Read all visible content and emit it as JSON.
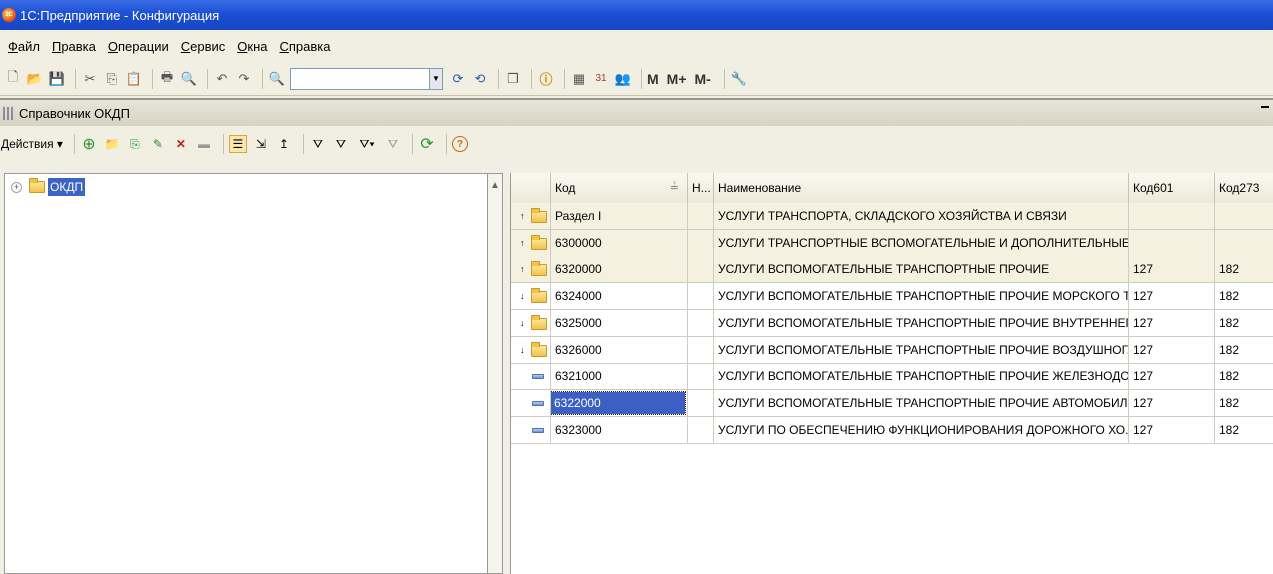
{
  "window": {
    "title": "1С:Предприятие - Конфигурация",
    "logo_text": "1С"
  },
  "menu": [
    {
      "label": "Файл",
      "ul": "Ф",
      "rest": "айл"
    },
    {
      "label": "Правка",
      "ul": "П",
      "rest": "равка"
    },
    {
      "label": "Операции",
      "ul": "О",
      "rest": "перации"
    },
    {
      "label": "Сервис",
      "ul": "С",
      "rest": "ервис"
    },
    {
      "label": "Окна",
      "ul": "О",
      "rest": "кна"
    },
    {
      "label": "Справка",
      "ul": "С",
      "rest": "правка"
    }
  ],
  "toolbar": {
    "search_value": "",
    "m_label": "M",
    "mplus_label": "M+",
    "mminus_label": "M-"
  },
  "document": {
    "title": "Справочник ОКДП"
  },
  "form_toolbar": {
    "actions_label": "Действия"
  },
  "tree": {
    "root_label": "ОКДП"
  },
  "grid": {
    "columns": [
      "Код",
      "Н...",
      "Наименование",
      "Код601",
      "Код273"
    ],
    "rows": [
      {
        "type": "folder",
        "arrow": "up",
        "code": "Раздел I",
        "n": "",
        "name": "УСЛУГИ ТРАНСПОРТА, СКЛАДСКОГО ХОЗЯЙСТВА И СВЯЗИ",
        "k601": "",
        "k273": ""
      },
      {
        "type": "folder",
        "arrow": "up",
        "code": "6300000",
        "n": "",
        "name": "УСЛУГИ ТРАНСПОРТНЫЕ ВСПОМОГАТЕЛЬНЫЕ И ДОПОЛНИТЕЛЬНЫЕ...",
        "k601": "",
        "k273": ""
      },
      {
        "type": "folder",
        "arrow": "up",
        "code": "6320000",
        "n": "",
        "name": "УСЛУГИ ВСПОМОГАТЕЛЬНЫЕ ТРАНСПОРТНЫЕ ПРОЧИЕ",
        "k601": "127",
        "k273": "182"
      },
      {
        "type": "folder",
        "arrow": "down",
        "code": "6324000",
        "n": "",
        "name": "УСЛУГИ ВСПОМОГАТЕЛЬНЫЕ ТРАНСПОРТНЫЕ ПРОЧИЕ МОРСКОГО Т...",
        "k601": "127",
        "k273": "182"
      },
      {
        "type": "folder",
        "arrow": "down",
        "code": "6325000",
        "n": "",
        "name": "УСЛУГИ ВСПОМОГАТЕЛЬНЫЕ ТРАНСПОРТНЫЕ ПРОЧИЕ ВНУТРЕННЕГ...",
        "k601": "127",
        "k273": "182"
      },
      {
        "type": "folder",
        "arrow": "down",
        "code": "6326000",
        "n": "",
        "name": "УСЛУГИ ВСПОМОГАТЕЛЬНЫЕ ТРАНСПОРТНЫЕ ПРОЧИЕ ВОЗДУШНОГ...",
        "k601": "127",
        "k273": "182"
      },
      {
        "type": "item",
        "arrow": "",
        "code": "6321000",
        "n": "",
        "name": "УСЛУГИ ВСПОМОГАТЕЛЬНЫЕ ТРАНСПОРТНЫЕ ПРОЧИЕ ЖЕЛЕЗНОДО...",
        "k601": "127",
        "k273": "182"
      },
      {
        "type": "item",
        "arrow": "",
        "code": "6322000",
        "n": "",
        "name": "УСЛУГИ ВСПОМОГАТЕЛЬНЫЕ ТРАНСПОРТНЫЕ ПРОЧИЕ АВТОМОБИЛ...",
        "k601": "127",
        "k273": "182",
        "selected": true
      },
      {
        "type": "item",
        "arrow": "",
        "code": "6323000",
        "n": "",
        "name": "УСЛУГИ ПО ОБЕСПЕЧЕНИЮ ФУНКЦИОНИРОВАНИЯ ДОРОЖНОГО ХО...",
        "k601": "127",
        "k273": "182"
      }
    ]
  }
}
